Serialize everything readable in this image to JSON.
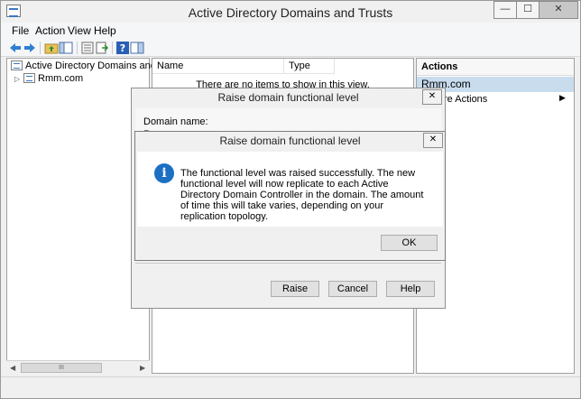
{
  "window": {
    "title": "Active Directory Domains and Trusts",
    "controls": {
      "minimize": "—",
      "maximize": "☐",
      "close": "✕"
    }
  },
  "menu": [
    "File",
    "Action",
    "View",
    "Help"
  ],
  "toolbar_icons": [
    "back-icon",
    "forward-icon",
    "up-folder-icon",
    "show-hide-tree-icon",
    "properties-icon",
    "export-icon",
    "help-icon",
    "panel-icon"
  ],
  "tree": {
    "root": "Active Directory Domains and Trust",
    "child": "Rmm.com"
  },
  "list": {
    "columns": [
      "Name",
      "Type"
    ],
    "empty_message": "There are no items to show in this view."
  },
  "actions": {
    "header": "Actions",
    "selected": "Rmm.com",
    "more": "re Actions"
  },
  "dialog_outer": {
    "title": "Raise domain functional level",
    "domain_label": "Domain name:",
    "domain_value_partial": "R",
    "buttons": {
      "raise": "Raise",
      "cancel": "Cancel",
      "help": "Help"
    },
    "close": "✕"
  },
  "dialog_inner": {
    "title": "Raise domain functional level",
    "message": "The functional level was raised successfully. The new functional level will now replicate to each Active Directory Domain Controller in the domain. The amount of time this will take varies, depending on your replication topology.",
    "ok": "OK",
    "close": "✕"
  },
  "scrollbar": {
    "left": "◀",
    "right": "▶",
    "thumb": "III"
  },
  "tree_expander": "▷",
  "actions_arrow": "▶",
  "info_glyph": "i"
}
